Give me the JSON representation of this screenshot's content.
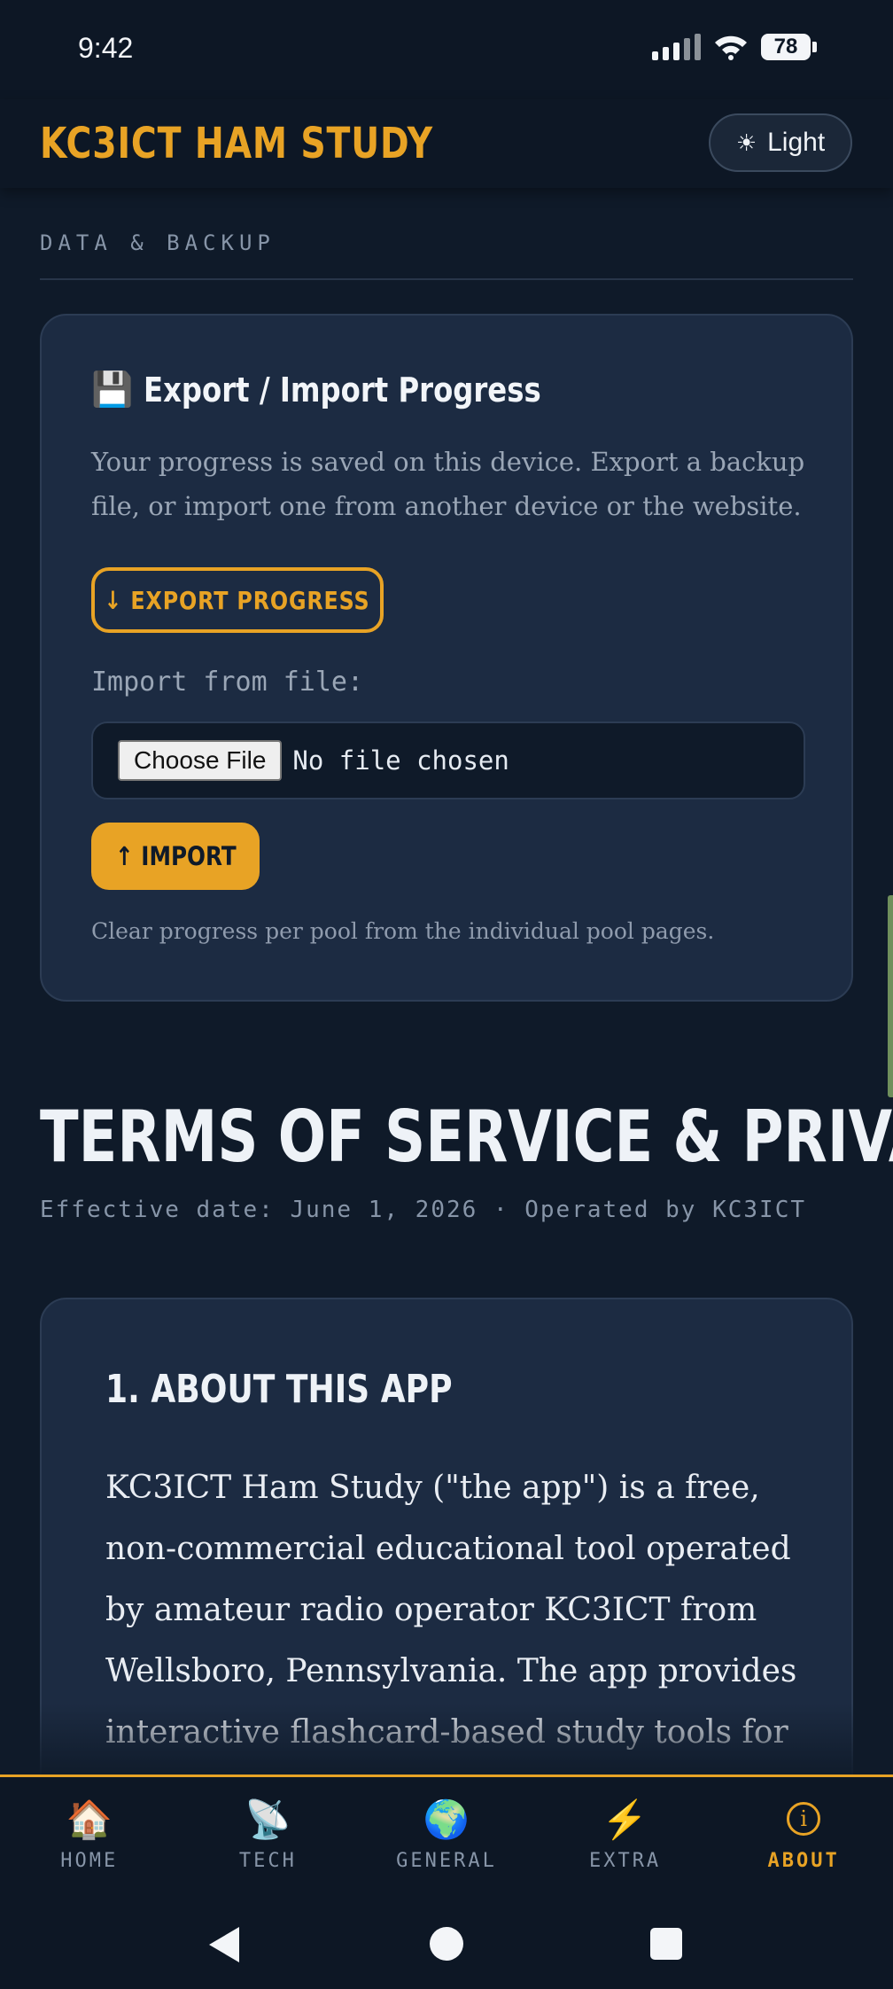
{
  "status_bar": {
    "time": "9:42",
    "battery": "78"
  },
  "header": {
    "title": "KC3ICT HAM STUDY",
    "theme_toggle": {
      "icon": "sun-icon",
      "label": "Light"
    }
  },
  "backup": {
    "section_label": "DATA & BACKUP",
    "card_icon": "floppy-disk-icon",
    "card_title": "Export / Import Progress",
    "description": "Your progress is saved on this device. Export a backup file, or import one from another device or the website.",
    "export_label": "↓ EXPORT PROGRESS",
    "import_from_label": "Import from file:",
    "choose_file_label": "Choose File",
    "no_file_label": "No file chosen",
    "import_label": "↑ IMPORT",
    "note": "Clear progress per pool from the individual pool pages."
  },
  "terms": {
    "title": "TERMS OF SERVICE & PRIVACY",
    "meta": "Effective date: June 1, 2026  ·  Operated by KC3ICT",
    "section_heading": "1. ABOUT THIS APP",
    "section_body": "KC3ICT Ham Study (\"the app\") is a free, non-commercial educational tool operated by amateur radio operator KC3ICT from Wellsboro, Pennsylvania. The app provides interactive flashcard-based study tools for"
  },
  "bottom_nav": {
    "items": [
      {
        "label": "HOME",
        "icon": "house-icon"
      },
      {
        "label": "TECH",
        "icon": "satellite-dish-icon"
      },
      {
        "label": "GENERAL",
        "icon": "globe-icon"
      },
      {
        "label": "EXTRA",
        "icon": "lightning-icon"
      },
      {
        "label": "ABOUT",
        "icon": "info-icon",
        "active": true
      }
    ]
  },
  "colors": {
    "accent": "#e8a325",
    "background": "#0f1a29",
    "card": "#1c2b42"
  }
}
